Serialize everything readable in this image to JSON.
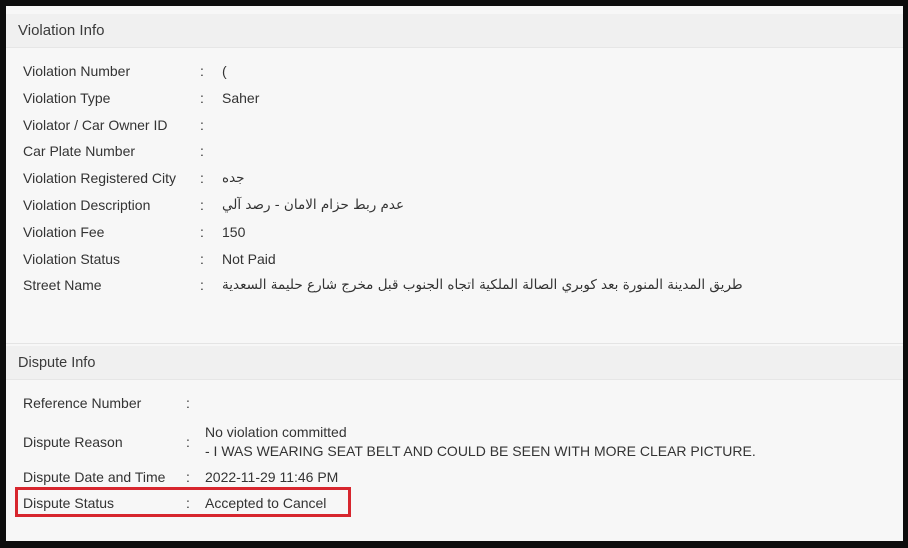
{
  "violation_info": {
    "title": "Violation Info",
    "fields": [
      {
        "label": "Violation Number",
        "value": "(",
        "rtl": false
      },
      {
        "label": "Violation Type",
        "value": "Saher",
        "rtl": false
      },
      {
        "label": "Violator / Car Owner ID",
        "value": "",
        "rtl": false
      },
      {
        "label": "Car Plate Number",
        "value": "",
        "rtl": false
      },
      {
        "label": "Violation Registered City",
        "value": "جده",
        "rtl": true
      },
      {
        "label": "Violation Description",
        "value": "عدم ربط حزام الامان - رصد آلي",
        "rtl": true
      },
      {
        "label": "Violation Fee",
        "value": "150",
        "rtl": false
      },
      {
        "label": "Violation Status",
        "value": "Not Paid",
        "rtl": false
      },
      {
        "label": "Street Name",
        "value": "طريق المدينة المنورة بعد كوبري الصالة الملكية اتجاه الجنوب قبل مخرج شارع حليمة السعدية",
        "rtl": true
      }
    ]
  },
  "dispute_info": {
    "title": "Dispute Info",
    "reference_number": {
      "label": "Reference Number",
      "value": ""
    },
    "dispute_reason": {
      "label": "Dispute Reason",
      "line1": "No violation committed",
      "line2": "- I WAS WEARING SEAT BELT AND COULD BE SEEN WITH MORE CLEAR PICTURE."
    },
    "dispute_date": {
      "label": "Dispute Date and Time",
      "value": "2022-11-29 11:46 PM"
    },
    "dispute_status": {
      "label": "Dispute Status",
      "value": "Accepted to Cancel"
    }
  },
  "colon": ":",
  "colors": {
    "highlight": "#d7262e"
  }
}
